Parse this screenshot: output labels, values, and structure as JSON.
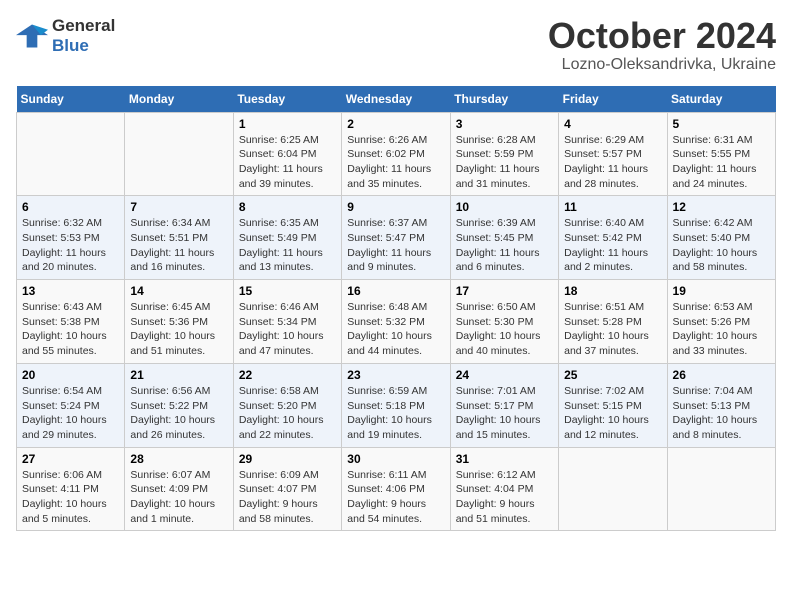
{
  "header": {
    "logo_line1": "General",
    "logo_line2": "Blue",
    "month_title": "October 2024",
    "subtitle": "Lozno-Oleksandrivka, Ukraine"
  },
  "weekdays": [
    "Sunday",
    "Monday",
    "Tuesday",
    "Wednesday",
    "Thursday",
    "Friday",
    "Saturday"
  ],
  "weeks": [
    [
      {
        "day": "",
        "info": ""
      },
      {
        "day": "",
        "info": ""
      },
      {
        "day": "1",
        "info": "Sunrise: 6:25 AM\nSunset: 6:04 PM\nDaylight: 11 hours\nand 39 minutes."
      },
      {
        "day": "2",
        "info": "Sunrise: 6:26 AM\nSunset: 6:02 PM\nDaylight: 11 hours\nand 35 minutes."
      },
      {
        "day": "3",
        "info": "Sunrise: 6:28 AM\nSunset: 5:59 PM\nDaylight: 11 hours\nand 31 minutes."
      },
      {
        "day": "4",
        "info": "Sunrise: 6:29 AM\nSunset: 5:57 PM\nDaylight: 11 hours\nand 28 minutes."
      },
      {
        "day": "5",
        "info": "Sunrise: 6:31 AM\nSunset: 5:55 PM\nDaylight: 11 hours\nand 24 minutes."
      }
    ],
    [
      {
        "day": "6",
        "info": "Sunrise: 6:32 AM\nSunset: 5:53 PM\nDaylight: 11 hours\nand 20 minutes."
      },
      {
        "day": "7",
        "info": "Sunrise: 6:34 AM\nSunset: 5:51 PM\nDaylight: 11 hours\nand 16 minutes."
      },
      {
        "day": "8",
        "info": "Sunrise: 6:35 AM\nSunset: 5:49 PM\nDaylight: 11 hours\nand 13 minutes."
      },
      {
        "day": "9",
        "info": "Sunrise: 6:37 AM\nSunset: 5:47 PM\nDaylight: 11 hours\nand 9 minutes."
      },
      {
        "day": "10",
        "info": "Sunrise: 6:39 AM\nSunset: 5:45 PM\nDaylight: 11 hours\nand 6 minutes."
      },
      {
        "day": "11",
        "info": "Sunrise: 6:40 AM\nSunset: 5:42 PM\nDaylight: 11 hours\nand 2 minutes."
      },
      {
        "day": "12",
        "info": "Sunrise: 6:42 AM\nSunset: 5:40 PM\nDaylight: 10 hours\nand 58 minutes."
      }
    ],
    [
      {
        "day": "13",
        "info": "Sunrise: 6:43 AM\nSunset: 5:38 PM\nDaylight: 10 hours\nand 55 minutes."
      },
      {
        "day": "14",
        "info": "Sunrise: 6:45 AM\nSunset: 5:36 PM\nDaylight: 10 hours\nand 51 minutes."
      },
      {
        "day": "15",
        "info": "Sunrise: 6:46 AM\nSunset: 5:34 PM\nDaylight: 10 hours\nand 47 minutes."
      },
      {
        "day": "16",
        "info": "Sunrise: 6:48 AM\nSunset: 5:32 PM\nDaylight: 10 hours\nand 44 minutes."
      },
      {
        "day": "17",
        "info": "Sunrise: 6:50 AM\nSunset: 5:30 PM\nDaylight: 10 hours\nand 40 minutes."
      },
      {
        "day": "18",
        "info": "Sunrise: 6:51 AM\nSunset: 5:28 PM\nDaylight: 10 hours\nand 37 minutes."
      },
      {
        "day": "19",
        "info": "Sunrise: 6:53 AM\nSunset: 5:26 PM\nDaylight: 10 hours\nand 33 minutes."
      }
    ],
    [
      {
        "day": "20",
        "info": "Sunrise: 6:54 AM\nSunset: 5:24 PM\nDaylight: 10 hours\nand 29 minutes."
      },
      {
        "day": "21",
        "info": "Sunrise: 6:56 AM\nSunset: 5:22 PM\nDaylight: 10 hours\nand 26 minutes."
      },
      {
        "day": "22",
        "info": "Sunrise: 6:58 AM\nSunset: 5:20 PM\nDaylight: 10 hours\nand 22 minutes."
      },
      {
        "day": "23",
        "info": "Sunrise: 6:59 AM\nSunset: 5:18 PM\nDaylight: 10 hours\nand 19 minutes."
      },
      {
        "day": "24",
        "info": "Sunrise: 7:01 AM\nSunset: 5:17 PM\nDaylight: 10 hours\nand 15 minutes."
      },
      {
        "day": "25",
        "info": "Sunrise: 7:02 AM\nSunset: 5:15 PM\nDaylight: 10 hours\nand 12 minutes."
      },
      {
        "day": "26",
        "info": "Sunrise: 7:04 AM\nSunset: 5:13 PM\nDaylight: 10 hours\nand 8 minutes."
      }
    ],
    [
      {
        "day": "27",
        "info": "Sunrise: 6:06 AM\nSunset: 4:11 PM\nDaylight: 10 hours\nand 5 minutes."
      },
      {
        "day": "28",
        "info": "Sunrise: 6:07 AM\nSunset: 4:09 PM\nDaylight: 10 hours\nand 1 minute."
      },
      {
        "day": "29",
        "info": "Sunrise: 6:09 AM\nSunset: 4:07 PM\nDaylight: 9 hours\nand 58 minutes."
      },
      {
        "day": "30",
        "info": "Sunrise: 6:11 AM\nSunset: 4:06 PM\nDaylight: 9 hours\nand 54 minutes."
      },
      {
        "day": "31",
        "info": "Sunrise: 6:12 AM\nSunset: 4:04 PM\nDaylight: 9 hours\nand 51 minutes."
      },
      {
        "day": "",
        "info": ""
      },
      {
        "day": "",
        "info": ""
      }
    ]
  ]
}
